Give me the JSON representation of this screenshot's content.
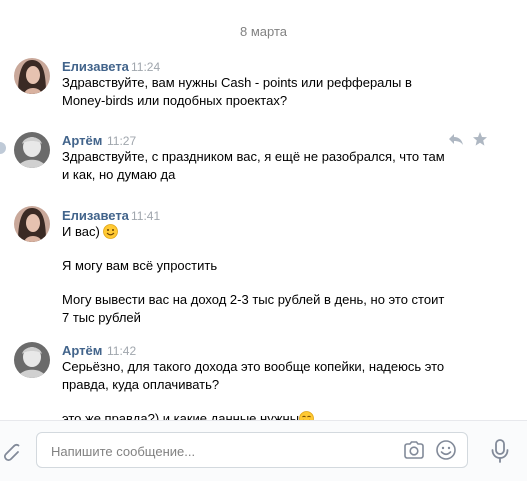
{
  "date_separator": "8 марта",
  "messages": [
    {
      "author": "Елизавета",
      "time": "11:24",
      "lines": [
        "Здравствуйте, вам нужны Cash - points или рефферaлы в",
        "Money-birds или подобных проектах?"
      ]
    },
    {
      "author": "Артём",
      "time": "11:27",
      "lines": [
        "Здравствуйте, с праздником вас, я ещё не разобрался, что там",
        "и как, но думаю да"
      ]
    },
    {
      "author": "Елизавета",
      "time": "11:41",
      "lines": [
        "И вас)",
        "Я могу вам всё упростить",
        "Могу вывести вас на доход 2-3 тыс рублей в день, но это стоит",
        "7 тыс рублей"
      ]
    },
    {
      "author": "Артём",
      "time": "11:42",
      "lines": [
        "Серьёзно, для такого дохода это вообще копейки, надеюсь это",
        "правда, куда оплачивать?",
        "это же правда?) и какие данные нужны"
      ]
    }
  ],
  "composer": {
    "placeholder": "Напишите сообщение..."
  },
  "colors": {
    "author": "#42648b",
    "time": "#a0a6ad",
    "icon": "#828a99"
  }
}
